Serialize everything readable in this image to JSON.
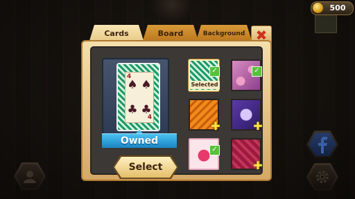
{
  "top": {
    "coins": "500"
  },
  "tabs": [
    {
      "label": "Cards",
      "active": true
    },
    {
      "label": "Board",
      "active": false
    },
    {
      "label": "Background",
      "active": false
    }
  ],
  "preview": {
    "status": "Owned",
    "select_label": "Select"
  },
  "thumbs": [
    {
      "label": "Selected",
      "owned": true
    },
    {
      "owned": true
    },
    {
      "owned": false
    },
    {
      "owned": false
    },
    {
      "owned": true
    },
    {
      "owned": false
    }
  ],
  "icons": {
    "coin": "coin-icon",
    "close": "close-icon",
    "facebook": "facebook-icon",
    "settings": "gear-icon",
    "profile": "user-icon"
  },
  "colors": {
    "accent": "#f4dfac",
    "owned_bar": "#2aa0dd",
    "check": "#56c23b",
    "plus": "#ffe33a",
    "close": "#d22f1e"
  }
}
